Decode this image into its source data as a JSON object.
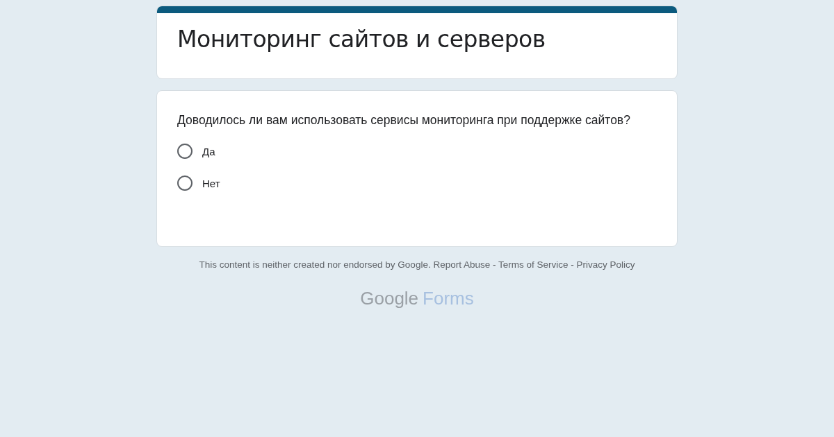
{
  "form": {
    "title": "Мониторинг сайтов и серверов"
  },
  "question": {
    "text": "Доводилось ли вам использовать сервисы мониторинга при поддержке сайтов?",
    "options": [
      {
        "label": "Да",
        "selected": false
      },
      {
        "label": "Нет",
        "selected": false
      }
    ]
  },
  "footer": {
    "notice": "This content is neither created nor endorsed by Google.",
    "links": [
      "Report Abuse",
      "Terms of Service",
      "Privacy Policy"
    ],
    "separator": "-"
  },
  "logo": {
    "brand": "Google",
    "product": "Forms"
  }
}
